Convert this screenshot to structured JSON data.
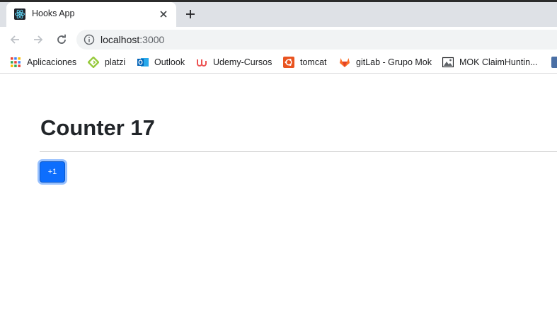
{
  "browser": {
    "tab": {
      "title": "Hooks App",
      "favicon": "react-icon"
    },
    "address": {
      "host": "localhost",
      "port": ":3000"
    },
    "bookmarks": [
      {
        "label": "Aplicaciones",
        "icon": "apps-grid-icon"
      },
      {
        "label": "platzi",
        "icon": "platzi-icon"
      },
      {
        "label": "Outlook",
        "icon": "outlook-icon"
      },
      {
        "label": "Udemy-Cursos",
        "icon": "udemy-icon"
      },
      {
        "label": "tomcat",
        "icon": "ubuntu-icon"
      },
      {
        "label": "gitLab - Grupo Mok",
        "icon": "gitlab-icon"
      },
      {
        "label": "MOK ClaimHuntin...",
        "icon": "image-icon"
      }
    ]
  },
  "page": {
    "heading": "Counter 17",
    "increment_button": "+1"
  },
  "colors": {
    "primary": "#0d6efd",
    "heading": "#212529",
    "tabstrip": "#dee1e6"
  }
}
